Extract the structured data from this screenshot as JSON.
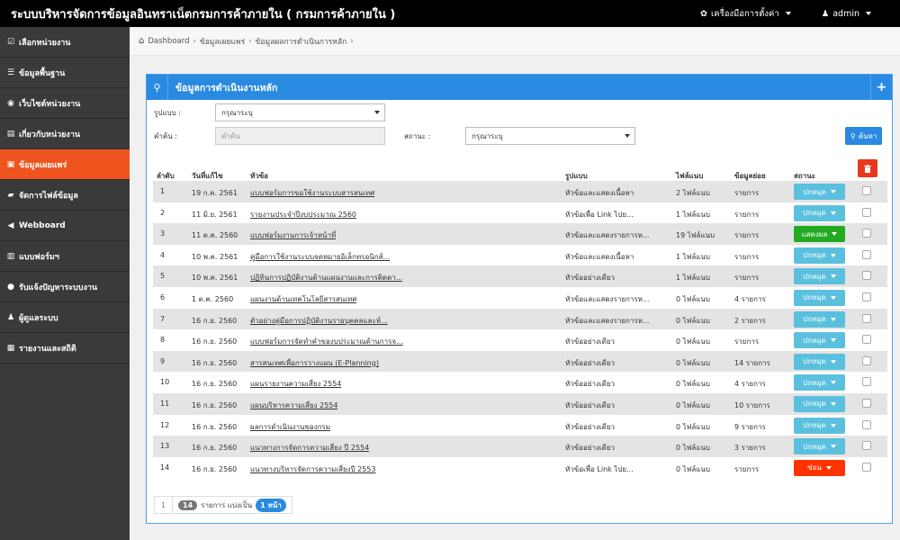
{
  "header": {
    "title": "ระบบบริหารจัดการข้อมูลอินทราเน็ตกรมการค้าภายใน ( กรมการค้าภายใน )",
    "tools_label": "เครื่องมือการตั้งค่า",
    "user_label": "admin"
  },
  "sidebar": {
    "items": [
      {
        "label": "เลือกหน่วยงาน",
        "icon": "check-icon",
        "glyph": "☑"
      },
      {
        "label": "ข้อมูลพื้นฐาน",
        "icon": "list-icon",
        "glyph": "☰"
      },
      {
        "label": "เว็บไซต์หน่วยงาน",
        "icon": "globe-icon",
        "glyph": "◉"
      },
      {
        "label": "เกี่ยวกับหน่วยงาน",
        "icon": "document-icon",
        "glyph": "▤"
      },
      {
        "label": "ข้อมูลเผยแพร่",
        "icon": "camera-icon",
        "glyph": "▣"
      },
      {
        "label": "จัดการไฟล์ข้อมูล",
        "icon": "folder-icon",
        "glyph": "▰"
      },
      {
        "label": "Webboard",
        "icon": "megaphone-icon",
        "glyph": "◀"
      },
      {
        "label": "แบบฟอร์มฯ",
        "icon": "form-icon",
        "glyph": "▥"
      },
      {
        "label": "รับแจ้งปัญหาระบบงาน",
        "icon": "info-icon",
        "glyph": "●"
      },
      {
        "label": "ผู้ดูแลระบบ",
        "icon": "user-icon",
        "glyph": "♟"
      },
      {
        "label": "รายงานและสถิติ",
        "icon": "chart-icon",
        "glyph": "▦"
      }
    ],
    "active_index": 4
  },
  "breadcrumb": {
    "home": "Dashboard",
    "level1": "ข้อมูลเผยแพร่",
    "level2": "ข้อมูลผลการดำเนินการหลัก"
  },
  "panel": {
    "title": "ข้อมูลการดำเนินงานหลัก"
  },
  "filters": {
    "format_label": "รูปแบบ :",
    "format_value": "กรุณาระบุ",
    "keyword_label": "คำค้น :",
    "keyword_placeholder": "คำค้น",
    "status_label": "สถานะ :",
    "status_value": "กรุณาระบุ",
    "search_label": "ค้นหา"
  },
  "table": {
    "columns": [
      "ลำดับ",
      "วันที่แก้ไข",
      "หัวข้อ",
      "รูปแบบ",
      "ไฟล์แนบ",
      "ข้อมูลย่อย",
      "สถานะ"
    ],
    "rows": [
      {
        "no": "1",
        "date": "19 ก.ค. 2561",
        "title": "แบบฟอร์มการขอใช้งานระบบสารสนเทศ",
        "format": "หัวข้อและแสดงเนื้อหา",
        "files": "2 ไฟล์แนบ",
        "sub": "รายการ",
        "status": "ปกหมุด",
        "status_color": "#5bc0de"
      },
      {
        "no": "2",
        "date": "11 มิ.ย. 2561",
        "title": "รายงานประจำปีงบประมาณ 2560",
        "format": "หัวข้อเพื่อ Link ไปย...",
        "files": "1 ไฟล์แนบ",
        "sub": "รายการ",
        "status": "ปกหมุด",
        "status_color": "#5bc0de"
      },
      {
        "no": "3",
        "date": "11 ต.ค. 2560",
        "title": "แบบฟอร์มงานการเจ้าหน้าที่",
        "format": "หัวข้อและแสดงรายการห...",
        "files": "19 ไฟล์แนบ",
        "sub": "รายการ",
        "status": "แสดงผล",
        "status_color": "#22aa22"
      },
      {
        "no": "4",
        "date": "10 พ.ค. 2561",
        "title": "คู่มือการใช้งานระบบจดหมายอิเล็กทรอนิกส์...",
        "format": "หัวข้อและแสดงเนื้อหา",
        "files": "1 ไฟล์แนบ",
        "sub": "รายการ",
        "status": "ปกหมุด",
        "status_color": "#5bc0de"
      },
      {
        "no": "5",
        "date": "10 พ.ค. 2561",
        "title": "ปฏิทินการปฏิบัติงานด้านแผนงานและการติดตา...",
        "format": "หัวข้ออย่างเดียว",
        "files": "1 ไฟล์แนบ",
        "sub": "รายการ",
        "status": "ปกหมุด",
        "status_color": "#5bc0de"
      },
      {
        "no": "6",
        "date": "1 ต.ค. 2560",
        "title": "แผนงานด้านเทคโนโลยีสารสนเทศ",
        "format": "หัวข้อและแสดงรายการห...",
        "files": "0 ไฟล์แนบ",
        "sub": "4 รายการ",
        "status": "ปกหมุด",
        "status_color": "#5bc0de"
      },
      {
        "no": "7",
        "date": "16 ก.ย. 2560",
        "title": "ตัวอย่างคู่มือการปฏิบัติงานรายบุคคลและห์...",
        "format": "หัวข้อและแสดงรายการห...",
        "files": "0 ไฟล์แนบ",
        "sub": "2 รายการ",
        "status": "ปกหมุด",
        "status_color": "#5bc0de"
      },
      {
        "no": "8",
        "date": "16 ก.ย. 2560",
        "title": "แบบฟอร์มการจัดทำคำของบประมาณด้านการจ...",
        "format": "หัวข้ออย่างเดียว",
        "files": "0 ไฟล์แนบ",
        "sub": "รายการ",
        "status": "ปกหมุด",
        "status_color": "#5bc0de"
      },
      {
        "no": "9",
        "date": "16 ก.ย. 2560",
        "title": "สารสนเทศเพื่อการวางแผน (E-Planning)",
        "format": "หัวข้ออย่างเดียว",
        "files": "0 ไฟล์แนบ",
        "sub": "14 รายการ",
        "status": "ปกหมุด",
        "status_color": "#5bc0de"
      },
      {
        "no": "10",
        "date": "16 ก.ย. 2560",
        "title": "แผนรายงานความเสี่ยง 2554",
        "format": "หัวข้ออย่างเดียว",
        "files": "0 ไฟล์แนบ",
        "sub": "4 รายการ",
        "status": "ปกหมุด",
        "status_color": "#5bc0de"
      },
      {
        "no": "11",
        "date": "16 ก.ย. 2560",
        "title": "แผนบริหารความเสี่ยง 2554",
        "format": "หัวข้ออย่างเดียว",
        "files": "0 ไฟล์แนบ",
        "sub": "10 รายการ",
        "status": "ปกหมุด",
        "status_color": "#5bc0de"
      },
      {
        "no": "12",
        "date": "16 ก.ย. 2560",
        "title": "ผลการดำเนินงานของกรม",
        "format": "หัวข้ออย่างเดียว",
        "files": "0 ไฟล์แนบ",
        "sub": "9 รายการ",
        "status": "ปกหมุด",
        "status_color": "#5bc0de"
      },
      {
        "no": "13",
        "date": "16 ก.ย. 2560",
        "title": "แนวทางการจัดการความเสี่ยง ปี 2554",
        "format": "หัวข้ออย่างเดียว",
        "files": "0 ไฟล์แนบ",
        "sub": "3 รายการ",
        "status": "ปกหมุด",
        "status_color": "#5bc0de"
      },
      {
        "no": "14",
        "date": "16 ก.ย. 2560",
        "title": "แนวทางบริหารจัดการความเสี่ยงปี 2553",
        "format": "หัวข้อเพื่อ Link ไปย...",
        "files": "0 ไฟล์แนบ",
        "sub": "รายการ",
        "status": "ซ่อน",
        "status_color": "#ff3300"
      }
    ]
  },
  "pager": {
    "page": "1",
    "total": "14",
    "per_label": "รายการ แบ่งเป็น",
    "pages": "1 หน้า"
  },
  "colors": {
    "accent": "#2a8ae2",
    "active_menu": "#f0541e",
    "delete": "#e8381e"
  }
}
